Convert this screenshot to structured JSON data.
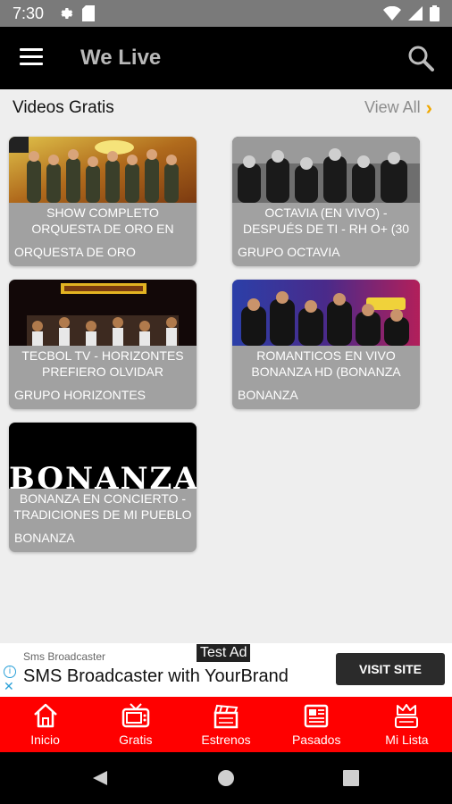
{
  "status_bar": {
    "time": "7:30"
  },
  "app_bar": {
    "title": "We Live"
  },
  "section": {
    "title": "Videos Gratis",
    "view_all": "View All"
  },
  "videos": [
    {
      "title": "SHOW COMPLETO ORQUESTA DE ORO EN",
      "artist": "ORQUESTA DE ORO"
    },
    {
      "title": "OCTAVIA (EN VIVO) - DESPUÉS DE TI - RH O+ (30",
      "artist": "GRUPO OCTAVIA"
    },
    {
      "title": "TECBOL TV - HORIZONTES PREFIERO OLVIDAR",
      "artist": "GRUPO HORIZONTES"
    },
    {
      "title": "ROMANTICOS EN VIVO BONANZA HD (BONANZA",
      "artist": "BONANZA"
    },
    {
      "title": "BONANZA EN CONCIERTO - TRADICIONES DE MI PUEBLO",
      "artist": "BONANZA",
      "thumb_text": "BONANZA"
    }
  ],
  "ad": {
    "label": "Test Ad",
    "sponsor": "Sms Broadcaster",
    "headline": "SMS Broadcaster with YourBrand",
    "cta": "VISIT SITE"
  },
  "bottom_nav": [
    {
      "label": "Inicio",
      "icon": "home-icon"
    },
    {
      "label": "Gratis",
      "icon": "tv-icon"
    },
    {
      "label": "Estrenos",
      "icon": "clapperboard-icon"
    },
    {
      "label": "Pasados",
      "icon": "newspaper-icon"
    },
    {
      "label": "Mi Lista",
      "icon": "crown-list-icon"
    }
  ],
  "colors": {
    "accent": "#ff0000",
    "view_all_chevron": "#f0a800",
    "card_bg": "#a1a1a1"
  }
}
